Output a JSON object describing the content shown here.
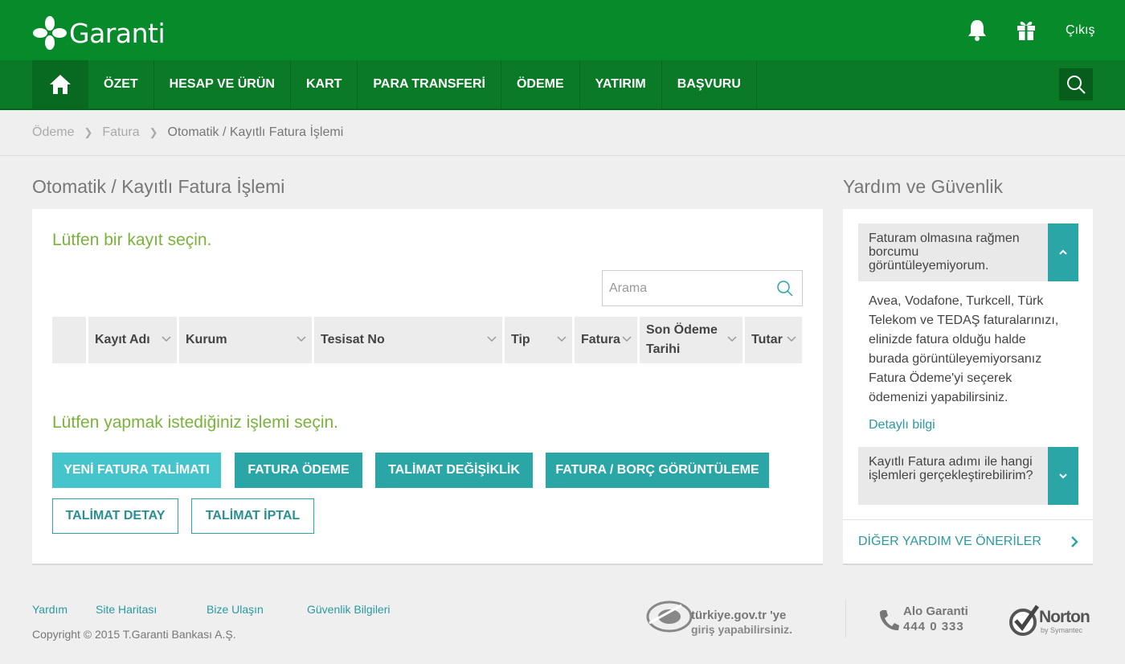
{
  "colors": {
    "brand_green": "#078a2a",
    "nav_green": "#0a7a26",
    "teal": "#2aa6a6",
    "light_teal": "#45c5cb",
    "section_green": "#7ab33a"
  },
  "header": {
    "logo_text": "Garanti",
    "icons": [
      "bell-icon",
      "gift-icon"
    ],
    "logout_label": "Çıkış"
  },
  "nav": {
    "home_icon": "home-icon",
    "items": [
      "ÖZET",
      "HESAP VE ÜRÜN",
      "KART",
      "PARA TRANSFERİ",
      "ÖDEME",
      "YATIRIM",
      "BAŞVURU"
    ],
    "search_icon": "search-icon"
  },
  "breadcrumb": {
    "items": [
      "Ödeme",
      "Fatura"
    ],
    "current": "Otomatik / Kayıtlı Fatura İşlemi"
  },
  "main": {
    "title": "Otomatik / Kayıtlı Fatura İşlemi",
    "select_record_title": "Lütfen bir kayıt seçin.",
    "search_placeholder": "Arama",
    "table_columns": [
      "Kayıt Adı",
      "Kurum",
      "Tesisat No",
      "Tip",
      "Fatura",
      "Son Ödeme Tarihi",
      "Tutar"
    ],
    "select_action_title": "Lütfen yapmak istediğiniz işlemi seçin.",
    "buttons": {
      "new_order": "YENİ FATURA TALİMATI",
      "pay_bill": "FATURA ÖDEME",
      "change_order": "TALİMAT DEĞİŞİKLİK",
      "view_bill": "FATURA / BORÇ GÖRÜNTÜLEME",
      "order_detail": "TALİMAT DETAY",
      "cancel_order": "TALİMAT İPTAL"
    }
  },
  "help": {
    "title": "Yardım ve Güvenlik",
    "q1": "Faturam olmasına rağmen borcumu görüntüleyemiyorum.",
    "a1": "Avea, Vodafone, Turkcell, Türk Telekom ve TEDAŞ faturalarınızı, elinizde fatura olduğu halde burada görüntüleyemiyorsanız Fatura Ödeme'yi seçerek ödemenizi yapabilirsiniz.",
    "a1_link": "Detaylı bilgi",
    "q2": "Kayıtlı Fatura adımı ile hangi işlemleri gerçekleştirebilirim?",
    "more_label": "DİĞER YARDIM VE ÖNERİLER"
  },
  "footer": {
    "links": [
      "Yardım",
      "Site Haritası",
      "Bize Ulaşın",
      "Güvenlik Bilgileri"
    ],
    "copyright": "Copyright © 2015 T.Garanti Bankası A.Ş.",
    "egov_line1": "türkiye.gov.tr 'ye",
    "egov_line2": "giriş yapabilirsiniz.",
    "alo_title": "Alo Garanti",
    "alo_number": "444 0 333",
    "norton_title": "Norton",
    "norton_sub": "by Symantec"
  }
}
